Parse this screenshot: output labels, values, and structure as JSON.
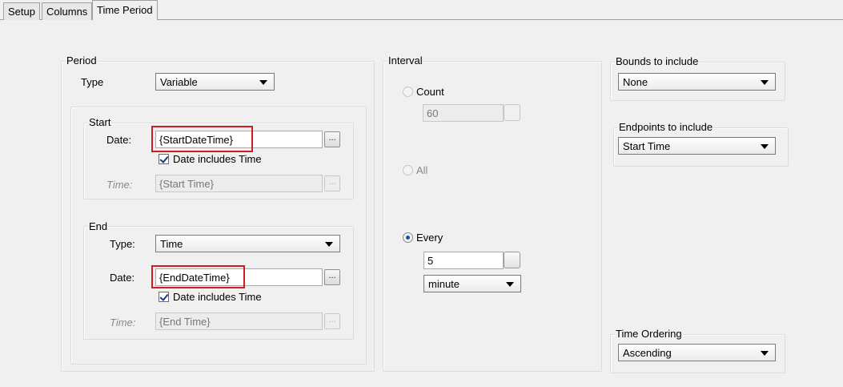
{
  "tabs": [
    {
      "label": "Setup",
      "active": false
    },
    {
      "label": "Columns",
      "active": false
    },
    {
      "label": "Time Period",
      "active": true
    }
  ],
  "period": {
    "title": "Period",
    "type_label": "Type",
    "type_value": "Variable",
    "start": {
      "title": "Start",
      "date_label": "Date:",
      "date_value": "{StartDateTime}",
      "date_button": "...",
      "includes_time_label": "Date includes Time",
      "includes_time_checked": true,
      "time_label": "Time:",
      "time_value": "{Start Time}",
      "time_button": "..."
    },
    "end": {
      "title": "End",
      "type_label": "Type:",
      "type_value": "Time",
      "date_label": "Date:",
      "date_value": "{EndDateTime}",
      "date_button": "...",
      "includes_time_label": "Date includes Time",
      "includes_time_checked": true,
      "time_label": "Time:",
      "time_value": "{End Time}",
      "time_button": "..."
    }
  },
  "interval": {
    "title": "Interval",
    "count_label": "Count",
    "count_value": "60",
    "all_label": "All",
    "every_label": "Every",
    "every_value": "5",
    "every_unit": "minute",
    "selected": "every"
  },
  "bounds": {
    "title": "Bounds to include",
    "value": "None"
  },
  "endpoints": {
    "title": "Endpoints to include",
    "value": "Start Time"
  },
  "ordering": {
    "title": "Time Ordering",
    "value": "Ascending"
  },
  "colors": {
    "highlight": "#d01c24",
    "background": "#f0f0f0",
    "radio_selected": "#1b4f9c"
  }
}
